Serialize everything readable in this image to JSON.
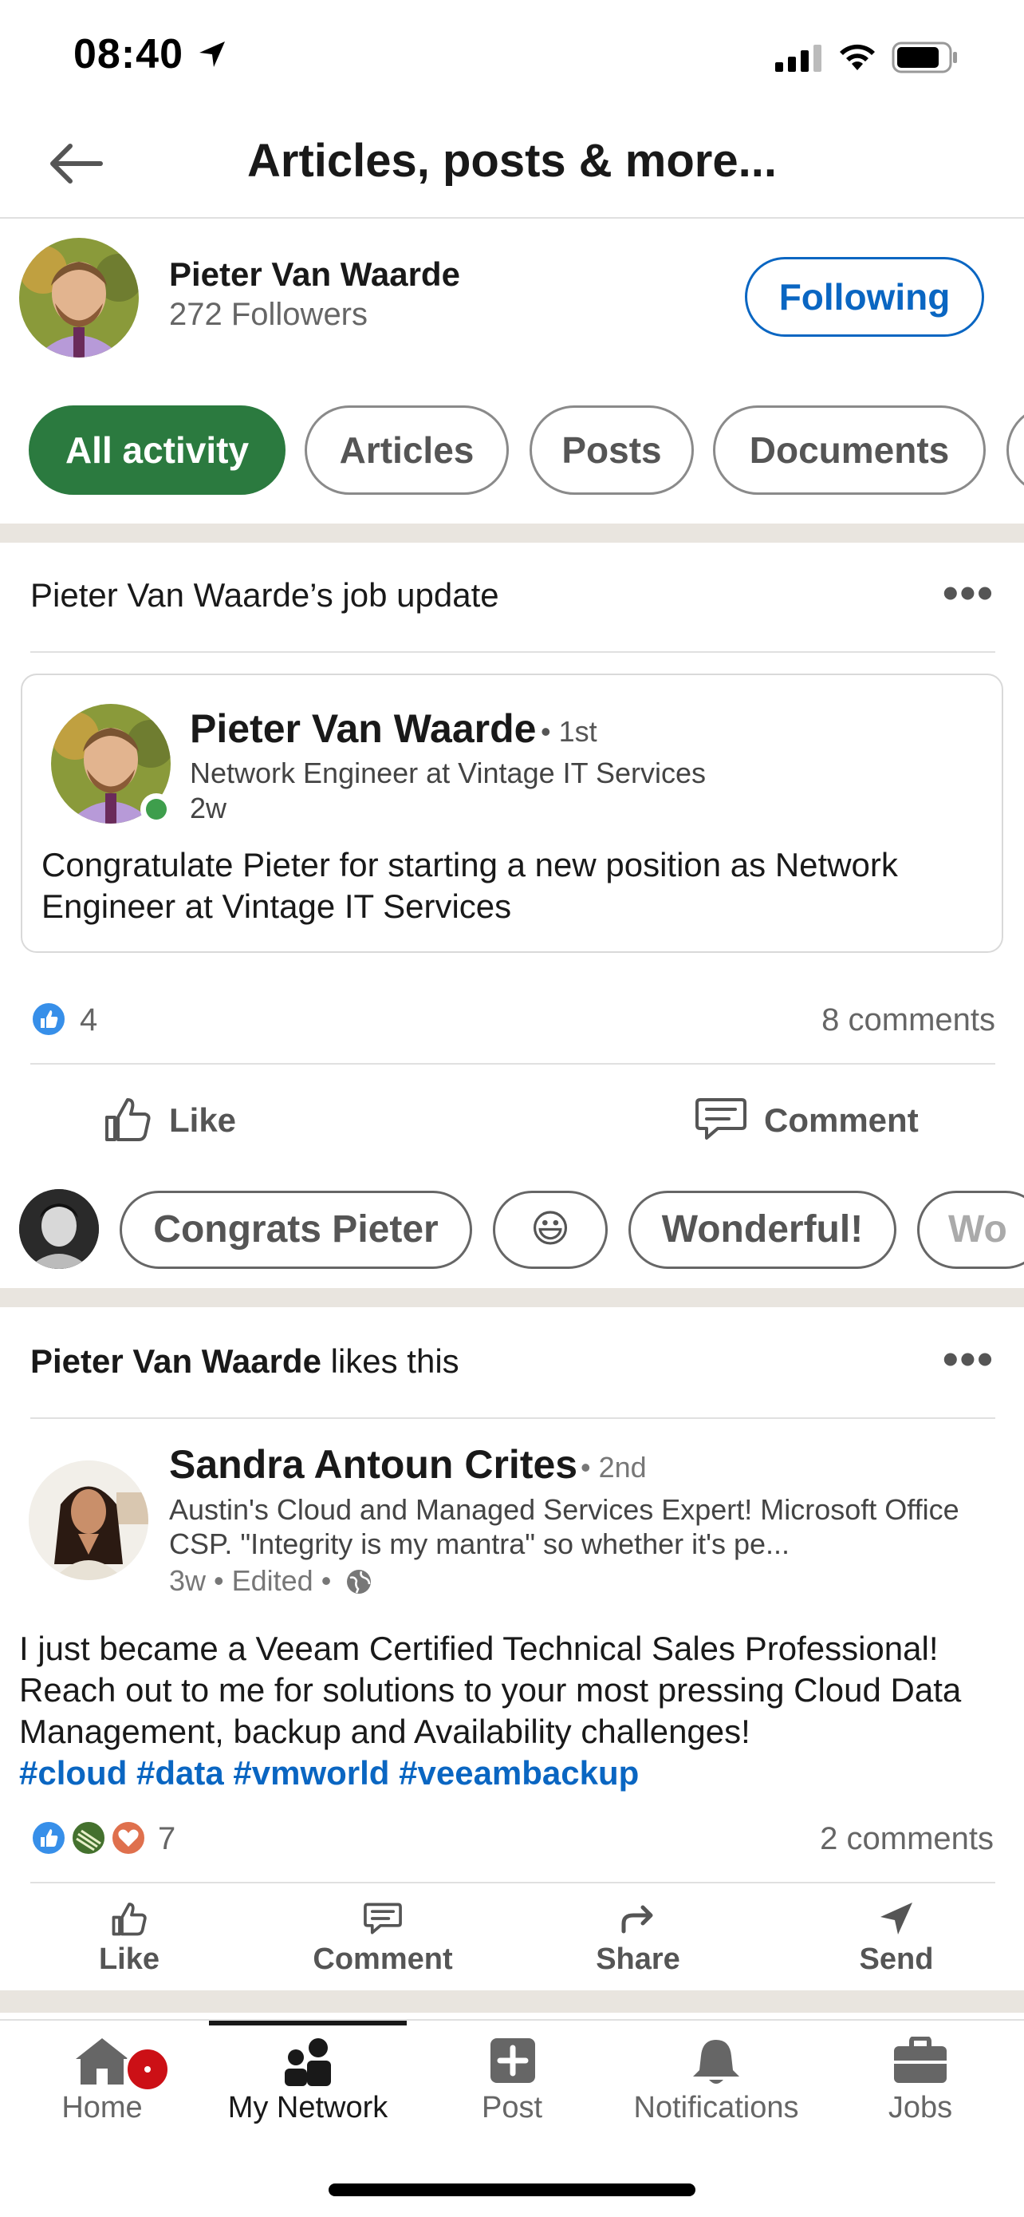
{
  "status_bar": {
    "time": "08:40"
  },
  "header": {
    "title": "Articles, posts & more..."
  },
  "profile": {
    "name": "Pieter Van Waarde",
    "followers": "272 Followers",
    "follow_label": "Following"
  },
  "filters": [
    "All activity",
    "Articles",
    "Posts",
    "Documents"
  ],
  "card1": {
    "headline": "Pieter Van Waarde’s job update",
    "author": "Pieter Van Waarde",
    "degree": "• 1st",
    "role": "Network Engineer at Vintage IT Services",
    "time": "2w",
    "body": "Congratulate Pieter for starting a new position as Network Engineer at Vintage IT Services",
    "reactions": "4",
    "comments": "8 comments",
    "like_label": "Like",
    "comment_label": "Comment",
    "quick_replies": [
      "Congrats Pieter",
      "😃",
      "Wonderful!",
      "Wo"
    ]
  },
  "card2": {
    "actor": "Pieter Van Waarde",
    "headline_suffix": " likes this",
    "author": "Sandra Antoun Crites",
    "degree": "• 2nd",
    "bio": "Austin's Cloud and Managed Services Expert! Microsoft Office CSP. \"Integrity is my mantra\" so whether it's pe...",
    "meta": "3w • Edited •",
    "body": "I just became a Veeam Certified Technical Sales Professional! Reach out to me for solutions to your most pressing Cloud Data Management, backup and Availability challenges!",
    "hashtags": "#cloud #data #vmworld #veeambackup",
    "reactions": "7",
    "comments": "2 comments",
    "actions": {
      "like": "Like",
      "comment": "Comment",
      "share": "Share",
      "send": "Send"
    }
  },
  "bottom_nav": {
    "home": "Home",
    "network": "My Network",
    "post": "Post",
    "notifications": "Notifications",
    "jobs": "Jobs"
  },
  "colors": {
    "linkedin_blue": "#0a66c2",
    "chip_active": "#2b7a3f",
    "separator": "#e9e5df"
  }
}
